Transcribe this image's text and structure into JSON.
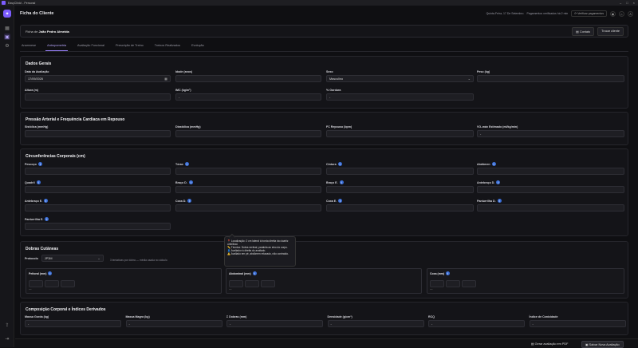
{
  "app": {
    "window_title": "EasyClinic! - Personal"
  },
  "header": {
    "title": "Ficha do Cliente",
    "date": "Quinta-Feira, 17 De Setembro",
    "payments": "Pagamentos verificados há 2 min",
    "verify_btn": "Verificar pagamentos"
  },
  "client": {
    "prefix": "Ficha de",
    "name": "João Pedro Almeida",
    "contact_btn": "Contato",
    "switch_btn": "Trocar cliente"
  },
  "tabs": [
    "Anamnese",
    "Antropometria",
    "Avaliação Funcional",
    "Prescrição de Treino",
    "Treinos Realizados",
    "Evolução"
  ],
  "general": {
    "title": "Dados Gerais",
    "date_label": "Data da Avaliação",
    "date_value": "17/09/2026",
    "age_label": "Idade (anos)",
    "sex_label": "Sexo",
    "sex_value": "Masculino",
    "weight_label": "Peso (kg)",
    "height_label": "Altura (m)",
    "imc_label": "IMC (kg/m²)",
    "imc_value": "-",
    "fat_label": "% Gordura",
    "fat_value": "-"
  },
  "bp": {
    "title": "Pressão Arterial e Frequência Cardíaca em Repouso",
    "sys": "Sistólica (mmHg)",
    "dia": "Diastólica (mmHg)",
    "hr": "FC Repouso (bpm)",
    "vo2": "VO₂máx Estimado (ml/kg/min)",
    "vo2_value": "-"
  },
  "circ": {
    "title": "Circunferências Corporais (cm)",
    "items": [
      "Pescoço",
      "Tórax",
      "Cintura",
      "Abdômen",
      "Quadril",
      "Braço D.",
      "Braço E.",
      "Antebraço D.",
      "Antebraço E.",
      "Coxa D.",
      "Coxa E.",
      "Panturrilha D.",
      "Panturrilha E."
    ]
  },
  "skin": {
    "title": "Dobras Cutâneas",
    "protocol_label": "Protocolo",
    "protocol_value": "JP3M",
    "note": "3 tentativas por dobra — média usada no cálculo",
    "sites": [
      "Peitoral (mm)",
      "Abdominal (mm)",
      "Coxa (mm)"
    ],
    "dash": "—"
  },
  "tooltip": {
    "l1": "📍 Localização: 2 cm lateral à borda direita da cicatriz umbilical.",
    "l2": "📏 Técnica: Dobra vertical, paralela ao eixo do corpo.",
    "l3": "👤 Avaliador à direita do avaliado.",
    "l4": "⚠️ Avaliado em pé, abdômen relaxado, não contraído."
  },
  "comp": {
    "title": "Composição Corporal e Índices Derivados",
    "items": [
      {
        "label": "Massa Gorda (kg)",
        "value": "-"
      },
      {
        "label": "Massa Magra (kg)",
        "value": "-"
      },
      {
        "label": "Σ Dobras (mm)",
        "value": "-"
      },
      {
        "label": "Densidade (g/cm³)",
        "value": "-"
      },
      {
        "label": "RCQ",
        "value": "-"
      },
      {
        "label": "Índice de Conicidade",
        "value": "-"
      }
    ]
  },
  "footer": {
    "pdf_btn": "Gerar avaliação em PDF",
    "save_btn": "Salvar Nova Avaliação"
  },
  "colors": {
    "accent": "#7c5cff",
    "info": "#3b6fd8"
  }
}
